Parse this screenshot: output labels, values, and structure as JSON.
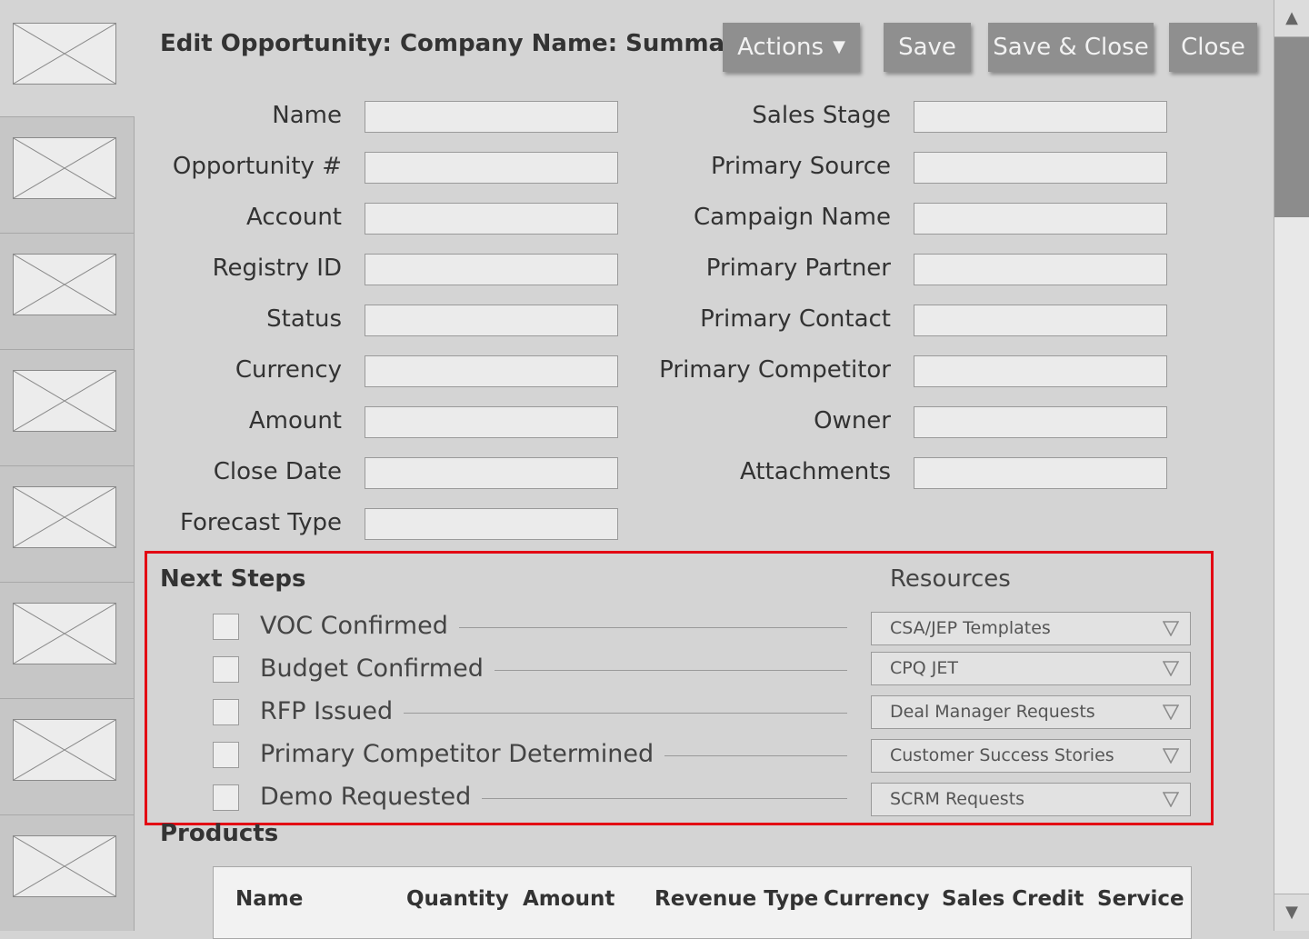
{
  "header": {
    "title": "Edit Opportunity: Company Name: Summary",
    "actions_label": "Actions",
    "save_label": "Save",
    "save_close_label": "Save & Close",
    "close_label": "Close"
  },
  "left_nav": {
    "items": [
      "image-placeholder",
      "image-placeholder",
      "image-placeholder",
      "image-placeholder",
      "image-placeholder",
      "image-placeholder",
      "image-placeholder"
    ]
  },
  "form": {
    "left_fields": [
      "Name",
      "Opportunity #",
      "Account",
      "Registry ID",
      "Status",
      "Currency",
      "Amount",
      "Close Date",
      "Forecast Type"
    ],
    "right_fields": [
      "Sales Stage",
      "Primary Source",
      "Campaign Name",
      "Primary Partner",
      "Primary Contact",
      "Primary Competitor",
      "Owner",
      "Attachments"
    ]
  },
  "next_steps": {
    "title": "Next Steps",
    "items": [
      "VOC Confirmed",
      "Budget Confirmed",
      "RFP Issued",
      "Primary Competitor Determined",
      "Demo Requested"
    ]
  },
  "resources": {
    "title": "Resources",
    "items": [
      "CSA/JEP Templates",
      "CPQ JET",
      "Deal Manager Requests",
      "Customer Success Stories",
      "SCRM Requests"
    ]
  },
  "products": {
    "title": "Products",
    "columns": [
      "Name",
      "Quantity",
      "Amount",
      "Revenue Type",
      "Currency",
      "Sales Credit",
      "Service"
    ]
  },
  "colors": {
    "highlight_border": "#e30613",
    "button_bg": "#8f8f8f",
    "page_bg": "#d4d4d4"
  },
  "icons": {
    "actions_caret": "caret-down-icon",
    "dropdown_arrow": "triangle-down-icon",
    "scroll_up": "scroll-up-icon",
    "scroll_down": "scroll-down-icon",
    "placeholder": "image-placeholder-icon"
  }
}
